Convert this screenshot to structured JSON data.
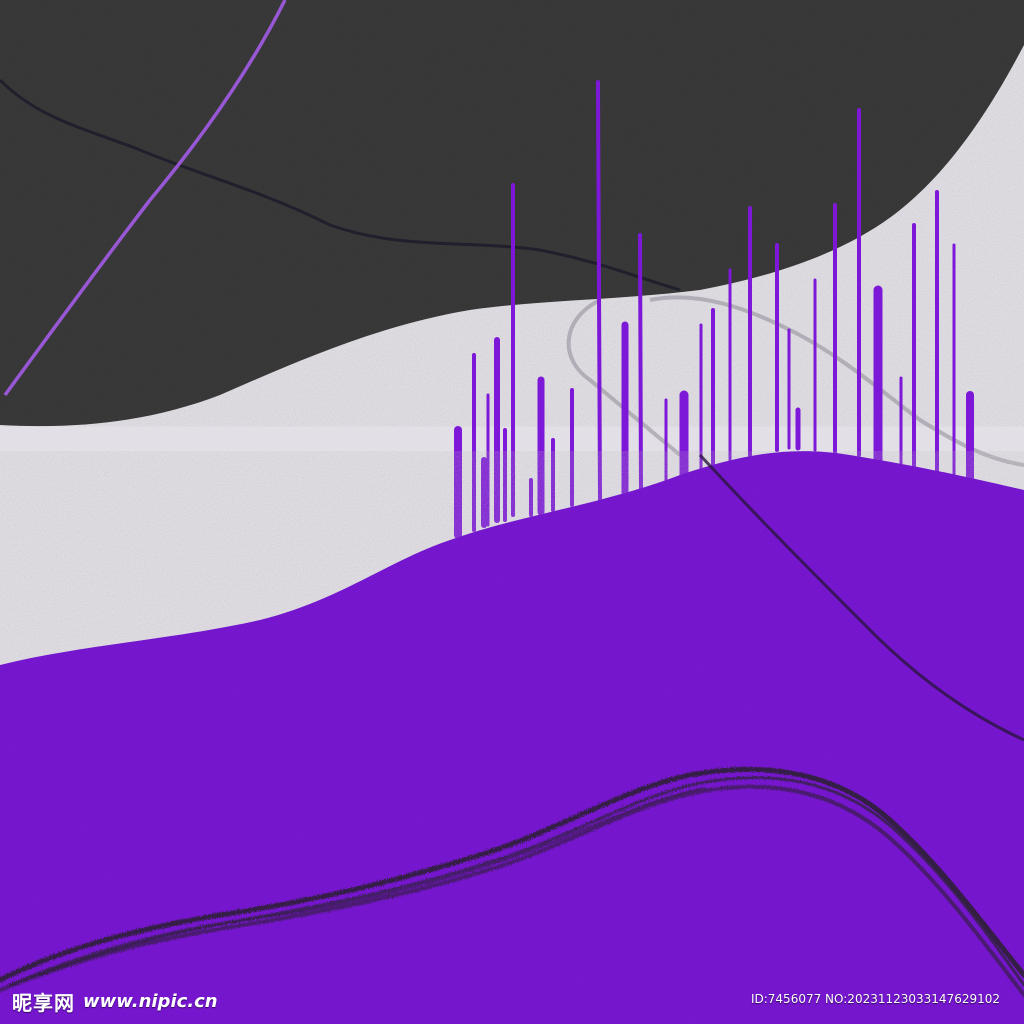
{
  "watermark": {
    "site_cn": "昵享网",
    "site_url": "www.nipic.cn",
    "id_text": "ID:7456077 NO:20231123033147629102"
  },
  "colors": {
    "background": "#e2dfe6",
    "dark_rock": "#3a3a3a",
    "purple": "#7a14d6",
    "purple_drip": "#7d18d8",
    "charcoal_stroke": "#2b2230",
    "glitter_line": "#a35ce8"
  }
}
